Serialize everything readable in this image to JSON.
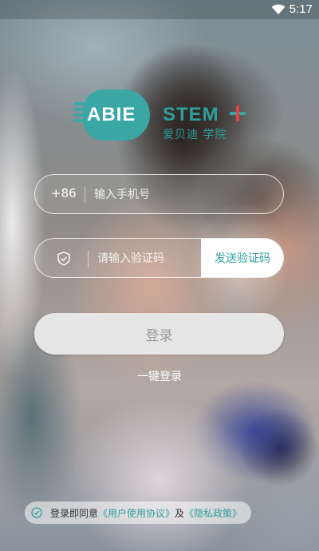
{
  "status_bar": {
    "time": "5:17",
    "wifi_icon": "wifi-icon"
  },
  "logo": {
    "brand_left": "ABIE",
    "brand_right": "STEM",
    "subtitle": "爱贝迪 学院"
  },
  "phone": {
    "country_code": "+86",
    "placeholder": "输入手机号",
    "value": ""
  },
  "code": {
    "placeholder": "请输入验证码",
    "value": "",
    "send_label": "发送验证码",
    "icon": "shield-check-icon"
  },
  "login": {
    "button_label": "登录",
    "one_key_label": "一键登录"
  },
  "agreement": {
    "prefix": "登录即同意",
    "user_agreement": "《用户使用协议》",
    "joiner": "及",
    "privacy_policy": "《隐私政策》",
    "check_icon": "check-circle-icon"
  },
  "colors": {
    "accent": "#2f9f9d",
    "plus_red": "#e0443c",
    "button_bg": "#e6e6e6"
  }
}
